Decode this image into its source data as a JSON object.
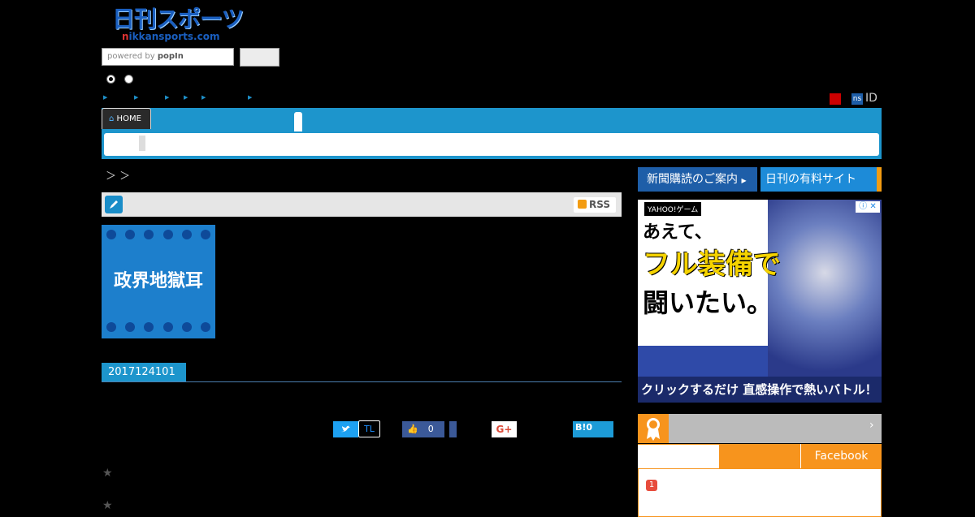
{
  "header": {
    "logo_main": "日刊スポーツ",
    "logo_sub_n": "n",
    "logo_sub_rest": "ikkansports.com",
    "search_placeholder": "powered by",
    "search_brand": "popIn",
    "id_label": "ID",
    "ns_badge": "ns"
  },
  "nav": {
    "home_label": "HOME"
  },
  "breadcrumb": {
    "text": "＞ ＞"
  },
  "article": {
    "rss_label": "RSS",
    "column_title": "政界地獄耳",
    "date_tag": "2017124101",
    "stars": [
      "★",
      "★"
    ]
  },
  "share": {
    "tl_label": "TL",
    "fb_count": "0",
    "gplus_label": "G+",
    "hatena_label": "B!",
    "hatena_count": "0"
  },
  "sidebar": {
    "subscribe_label": "新聞購読のご案内",
    "paid_site_label": "日刊の有料サイト",
    "ad": {
      "brand": "YAHOO!ゲーム",
      "line1": "あえて、",
      "line2": "フル装備で",
      "line3": "闘いたい。",
      "footer": "クリックするだけ 直感操作で熱いバトル！",
      "info": "ⓘ ✕"
    },
    "ranking": {
      "facebook_tab": "Facebook",
      "first_rank": "1"
    }
  },
  "colors": {
    "nav_blue": "#1d95cc",
    "accent_orange": "#f7941d",
    "dark_blue": "#1e5ea8"
  }
}
